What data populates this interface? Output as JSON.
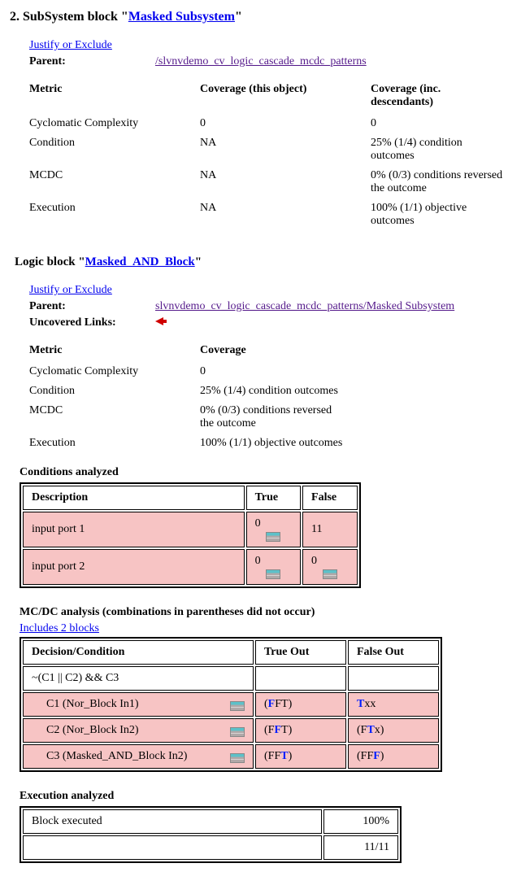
{
  "section1": {
    "prefix": "2. SubSystem block \"",
    "link": "Masked Subsystem",
    "suffix": "\"",
    "justify": "Justify or Exclude",
    "parentLabel": "Parent:",
    "parentLink": "/slvnvdemo_cv_logic_cascade_mcdc_patterns",
    "metricHeaders": [
      "Metric",
      "Coverage (this object)",
      "Coverage (inc. descendants)"
    ],
    "metrics": [
      {
        "name": "Cyclomatic Complexity",
        "self": "0",
        "desc": "0"
      },
      {
        "name": "Condition",
        "self": "NA",
        "desc": "25% (1/4) condition outcomes"
      },
      {
        "name": "MCDC",
        "self": "NA",
        "desc": "0% (0/3) conditions reversed the outcome"
      },
      {
        "name": "Execution",
        "self": "NA",
        "desc": "100% (1/1) objective outcomes"
      }
    ]
  },
  "section2": {
    "prefix": "Logic block \"",
    "link": "Masked_AND_Block",
    "suffix": "\"",
    "justify": "Justify or Exclude",
    "parentLabel": "Parent:",
    "parentLink": "slvnvdemo_cv_logic_cascade_mcdc_patterns/Masked Subsystem",
    "uncoveredLabel": "Uncovered Links:",
    "metricHeaders": [
      "Metric",
      "Coverage"
    ],
    "metrics": [
      {
        "name": "Cyclomatic Complexity",
        "cov": "0"
      },
      {
        "name": "Condition",
        "cov": "25% (1/4) condition outcomes"
      },
      {
        "name": "MCDC",
        "cov": "0% (0/3) conditions reversed the outcome"
      },
      {
        "name": "Execution",
        "cov": "100% (1/1) objective outcomes"
      }
    ]
  },
  "conditions": {
    "title": "Conditions analyzed",
    "headers": [
      "Description",
      "True",
      "False"
    ],
    "rows": [
      {
        "desc": "input port 1",
        "t": "0",
        "f": "11"
      },
      {
        "desc": "input port 2",
        "t": "0",
        "f": "0"
      }
    ]
  },
  "mcdc": {
    "title": "MC/DC analysis (combinations in parentheses did not occur)",
    "includes": "Includes 2 blocks",
    "headers": [
      "Decision/Condition",
      "True Out",
      "False Out"
    ],
    "expr": "~(C1 || C2) && C3",
    "rows": [
      {
        "name": "C1 (Nor_Block In1)",
        "t_open": "(",
        "t_b": "F",
        "t_rest": "FT)",
        "f_b": "T",
        "f_rest": "xx"
      },
      {
        "name": "C2 (Nor_Block In2)",
        "t_open": "(F",
        "t_b": "F",
        "t_rest": "T)",
        "f_open": "(F",
        "f_b": "T",
        "f_rest": "x)"
      },
      {
        "name": "C3 (Masked_AND_Block In2)",
        "t_open": "(FF",
        "t_b": "T",
        "t_rest": ")",
        "f_open": "(FF",
        "f_b": "F",
        "f_rest": ")"
      }
    ]
  },
  "exec": {
    "title": "Execution analyzed",
    "rows": [
      {
        "a": "Block executed",
        "b": "100%"
      },
      {
        "a": "",
        "b": "11/11"
      }
    ]
  }
}
